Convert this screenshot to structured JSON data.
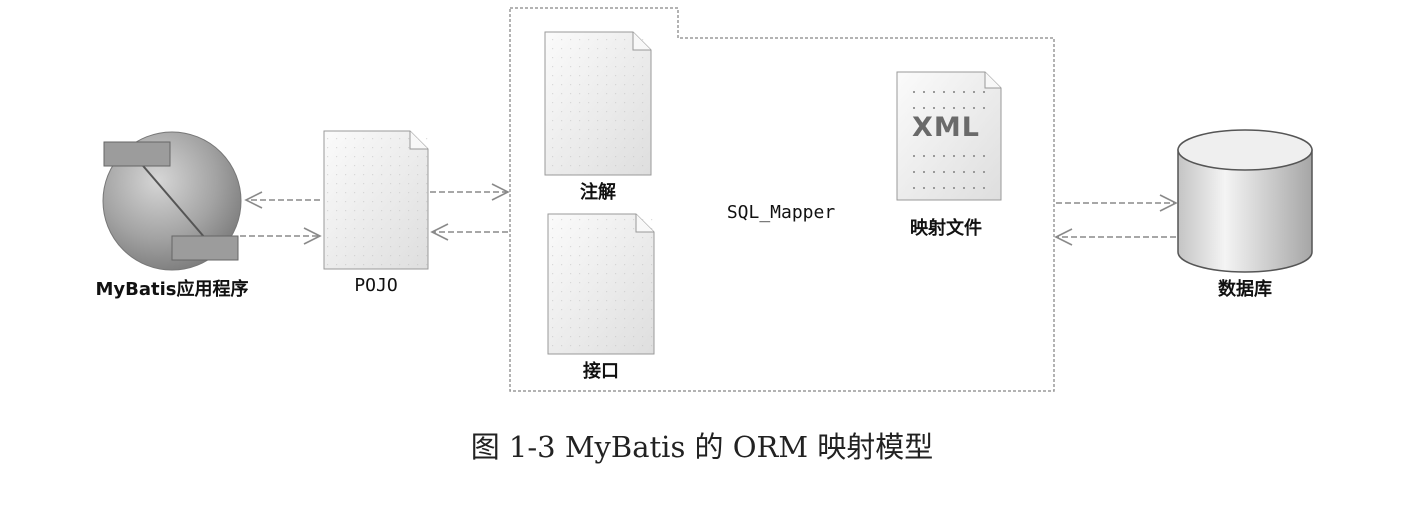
{
  "components": {
    "app": "MyBatis应用程序",
    "pojo": "POJO",
    "annotation": "注解",
    "interface": "接口",
    "mapper": "SQL_Mapper",
    "mapping_file": "映射文件",
    "xml_badge": "XML",
    "database": "数据库"
  },
  "caption": "图 1-3    MyBatis 的 ORM 映射模型",
  "colors": {
    "line": "#8a8a8a",
    "doc_fill": "#eeeeee",
    "globe": "#9a9a9a",
    "text": "#111111"
  },
  "icons": {
    "app": "globe-with-modules-icon",
    "document": "document-icon",
    "database": "cylinder-database-icon"
  }
}
